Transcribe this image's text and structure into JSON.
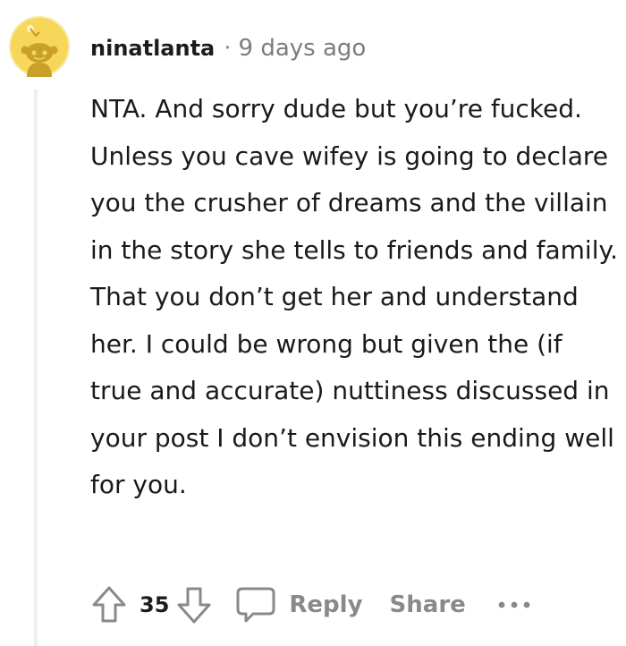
{
  "comment": {
    "author": "ninatlanta",
    "separator": "·",
    "timestamp": "9 days ago",
    "body": "NTA. And sorry dude but you’re fucked. Unless you cave wifey is going to declare you the crusher of dreams and the villain in the story she tells to friends and family. That you don’t get her and understand her. I could be wrong but given the (if true and accurate) nuttiness discussed in your post I don’t envision this ending well for you.",
    "score": "35"
  },
  "actions": {
    "reply_label": "Reply",
    "share_label": "Share",
    "more_label": "•••"
  },
  "icons": {
    "avatar": "reddit-snoo-avatar-icon",
    "upvote": "upvote-arrow-icon",
    "downvote": "downvote-arrow-icon",
    "reply": "comment-bubble-icon",
    "more": "more-dots-icon"
  },
  "colors": {
    "avatar_bg": "#f6d75a",
    "avatar_ring": "#fbe9a1",
    "meta_gray": "#878a8c",
    "thread_line": "#edeff1",
    "text": "#1a1a1b"
  }
}
